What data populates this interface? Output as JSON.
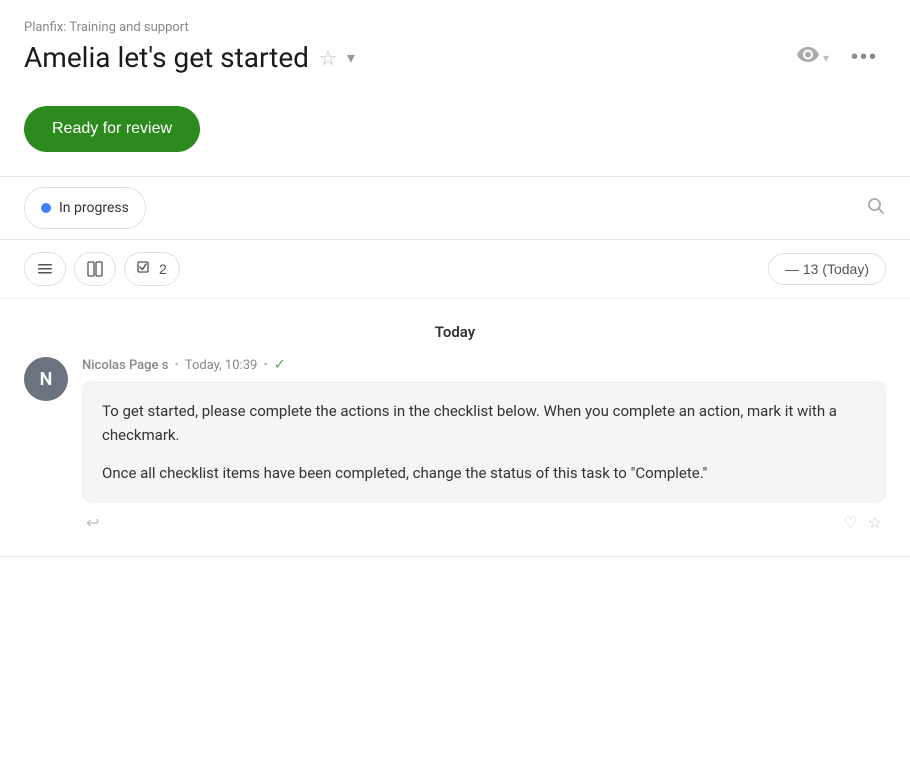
{
  "breadcrumb": {
    "text": "Planfix: Training and support"
  },
  "header": {
    "title": "Amelia let's get started",
    "star_label": "☆",
    "chevron_label": "▾"
  },
  "toolbar_actions": {
    "eye_icon": "👁",
    "more_label": "•••"
  },
  "status_button": {
    "label": "Ready for review"
  },
  "status_badge": {
    "label": "In progress"
  },
  "search_placeholder": "Search",
  "toolbar": {
    "list_icon": "≡",
    "split_icon": "⊞",
    "checklist_label": "2",
    "date_label": "— 13 (Today)"
  },
  "day_section": {
    "label": "Today"
  },
  "message": {
    "author": "Nicolas Page s",
    "time": "Today, 10:39",
    "avatar_letter": "N",
    "paragraph1": "To get started, please complete the actions in the checklist below. When you complete an action, mark it with a checkmark.",
    "paragraph2": "Once all checklist items have been completed, change the status of this task to \"Complete.\""
  }
}
